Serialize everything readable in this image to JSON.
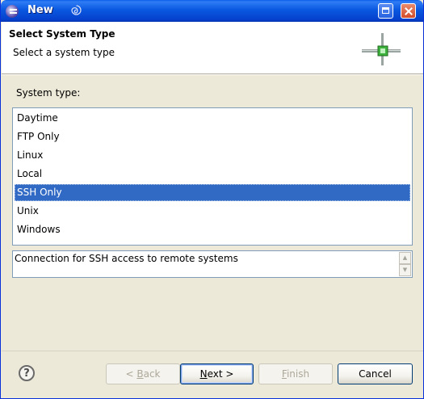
{
  "window": {
    "title": "New"
  },
  "header": {
    "title": "Select System Type",
    "description": "Select a system type"
  },
  "system_type": {
    "label": "System type:",
    "items": [
      {
        "label": "Daytime",
        "selected": false
      },
      {
        "label": "FTP Only",
        "selected": false
      },
      {
        "label": "Linux",
        "selected": false
      },
      {
        "label": "Local",
        "selected": false
      },
      {
        "label": "SSH Only",
        "selected": true
      },
      {
        "label": "Unix",
        "selected": false
      },
      {
        "label": "Windows",
        "selected": false
      }
    ]
  },
  "description_box": {
    "text": "Connection for SSH access to remote systems"
  },
  "buttons": {
    "back_prefix": "< ",
    "back_mnemonic": "B",
    "back_rest": "ack",
    "next_mnemonic": "N",
    "next_rest": "ext >",
    "finish_mnemonic": "F",
    "finish_rest": "inish",
    "cancel": "Cancel"
  },
  "icons": {
    "app": "eclipse-icon",
    "title_extra": "swirl-icon",
    "maximize": "maximize-icon",
    "close": "close-icon",
    "wizard": "connection-icon",
    "help": "help-icon"
  },
  "colors": {
    "selection": "#316ac5",
    "titlebar": "#0a58e0",
    "dialog_bg": "#ece9d8"
  }
}
